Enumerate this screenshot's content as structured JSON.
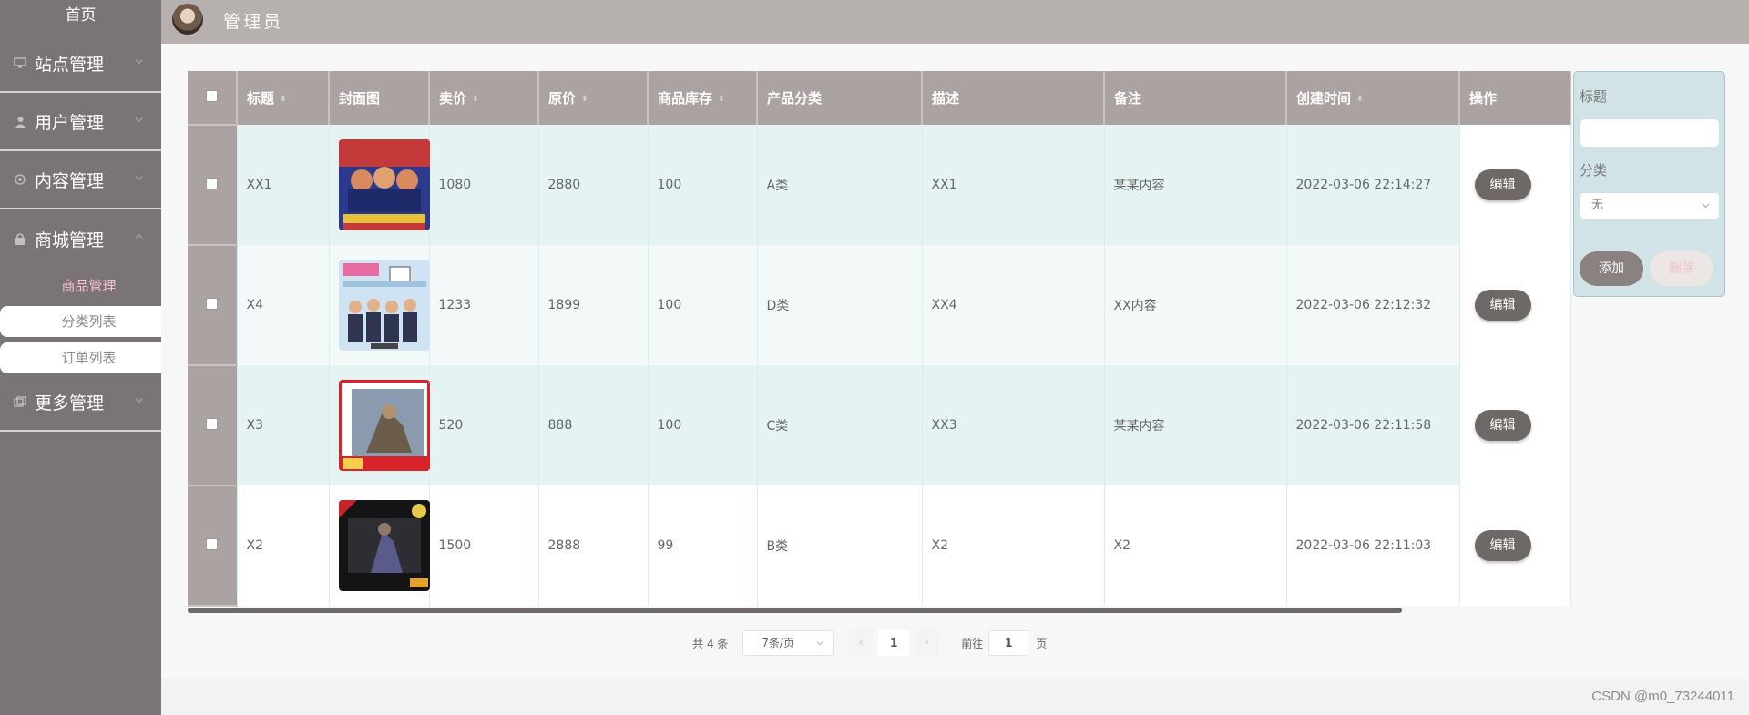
{
  "sidebar": {
    "home": "首页",
    "menus": [
      {
        "label": "站点管理",
        "icon": "monitor-icon"
      },
      {
        "label": "用户管理",
        "icon": "user-icon"
      },
      {
        "label": "内容管理",
        "icon": "eye-icon"
      },
      {
        "label": "商城管理",
        "icon": "lock-icon"
      }
    ],
    "submenu_title": "商品管理",
    "submenu_items": [
      "分类列表",
      "订单列表"
    ],
    "more": {
      "label": "更多管理",
      "icon": "copy-icon"
    }
  },
  "header": {
    "admin_name": "管理员"
  },
  "table": {
    "columns": {
      "title": "标题",
      "cover": "封面图",
      "price": "卖价",
      "original_price": "原价",
      "stock": "商品库存",
      "category": "产品分类",
      "description": "描述",
      "remark": "备注",
      "created": "创建时间",
      "action": "操作"
    },
    "edit_label": "编辑",
    "rows": [
      {
        "title": "XX1",
        "price": "1080",
        "original_price": "2880",
        "stock": "100",
        "category": "A类",
        "description": "XX1",
        "remark": "某某内容",
        "created": "2022-03-06 22:14:27"
      },
      {
        "title": "X4",
        "price": "1233",
        "original_price": "1899",
        "stock": "100",
        "category": "D类",
        "description": "XX4",
        "remark": "XX内容",
        "created": "2022-03-06 22:12:32"
      },
      {
        "title": "X3",
        "price": "520",
        "original_price": "888",
        "stock": "100",
        "category": "C类",
        "description": "XX3",
        "remark": "某某内容",
        "created": "2022-03-06 22:11:58"
      },
      {
        "title": "X2",
        "price": "1500",
        "original_price": "2888",
        "stock": "99",
        "category": "B类",
        "description": "X2",
        "remark": "X2",
        "created": "2022-03-06 22:11:03"
      }
    ]
  },
  "filter": {
    "title_label": "标题",
    "title_value": "",
    "category_label": "分类",
    "category_value": "无",
    "add_label": "添加",
    "delete_label": "删除"
  },
  "pagination": {
    "total": "共 4 条",
    "page_size": "7条/页",
    "prev": "‹",
    "current": "1",
    "next": "›",
    "goto_prefix": "前往",
    "goto_value": "1",
    "goto_suffix": "页"
  },
  "watermark": "CSDN @m0_73244011",
  "colors": {
    "sidebar": "#7b7475",
    "header": "#b6b0ae",
    "table_header": "#aaa3a1",
    "edit_button": "#6e6866",
    "filter_panel": "#d2e3e8"
  }
}
